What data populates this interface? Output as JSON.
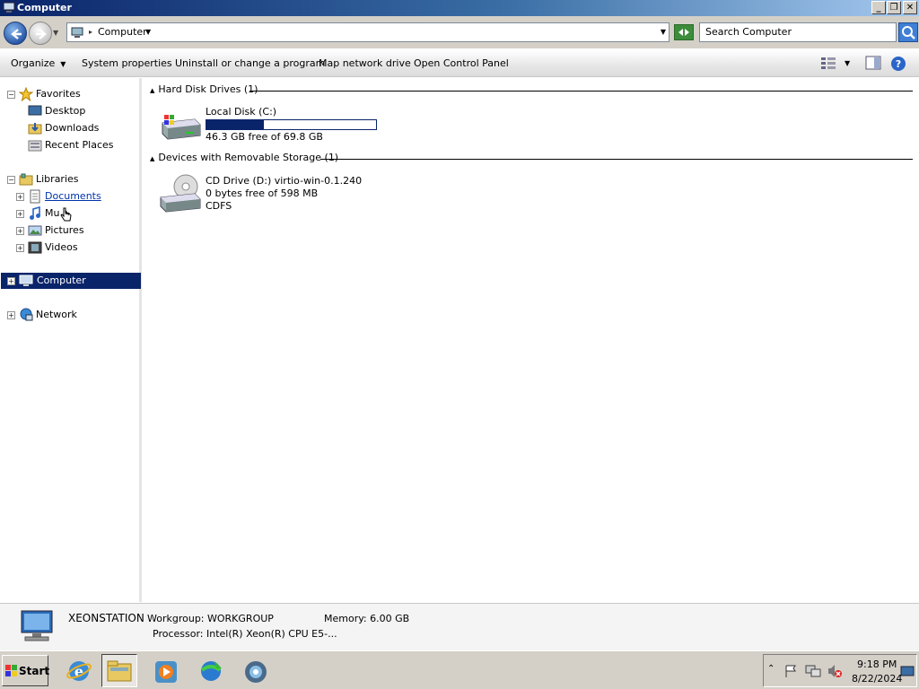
{
  "window": {
    "title": "Computer"
  },
  "address": {
    "crumb": "Computer",
    "search_placeholder": "Search Computer"
  },
  "toolbar": {
    "organize": "Organize",
    "system_properties": "System properties",
    "uninstall": "Uninstall or change a program",
    "map_drive": "Map network drive",
    "control_panel": "Open Control Panel"
  },
  "nav": {
    "favorites": "Favorites",
    "desktop": "Desktop",
    "downloads": "Downloads",
    "recent_places": "Recent Places",
    "libraries": "Libraries",
    "documents": "Documents",
    "music": "Mu",
    "pictures": "Pictures",
    "videos": "Videos",
    "computer": "Computer",
    "network": "Network"
  },
  "groups": {
    "hdd": "Hard Disk Drives (1)",
    "removable": "Devices with Removable Storage (1)"
  },
  "drives": {
    "c": {
      "name": "Local Disk (C:)",
      "free": "46.3 GB free of 69.8 GB",
      "used_fraction": 0.34
    },
    "d": {
      "name": "CD Drive (D:) virtio-win-0.1.240",
      "free": "0 bytes free of 598 MB",
      "fs": "CDFS"
    }
  },
  "details": {
    "computer_name": "XEONSTATION",
    "workgroup": "Workgroup: WORKGROUP",
    "memory": "Memory: 6.00 GB",
    "processor": "Processor: Intel(R) Xeon(R) CPU E5-..."
  },
  "taskbar": {
    "start": "Start",
    "time": "9:18 PM",
    "date": "8/22/2024"
  },
  "colors": {
    "selection": "#0a246a",
    "link": "#0033aa"
  }
}
